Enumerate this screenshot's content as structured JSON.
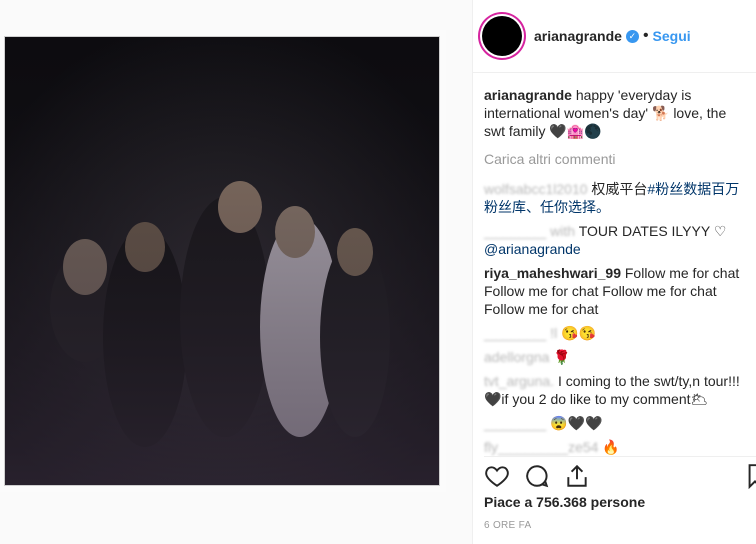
{
  "post": {
    "username": "arianagrande",
    "follow_label": "Segui",
    "separator": "•",
    "caption_user": "arianagrande",
    "caption_text": " happy 'everyday is international women's day' 🐕 love, the swt family 🖤🏩🌑",
    "load_more": "Carica altri commenti",
    "likes": "Piace a 756.368 persone",
    "time": "6 ORE FA"
  },
  "comments": [
    {
      "user": "",
      "prefix": "wolfsabcc1l2010 ",
      "text": "权威平台",
      "tag": "#粉丝数据百万粉丝库、任你选择。"
    },
    {
      "user": "",
      "prefix": "________ with ",
      "text": "TOUR DATES ILYYY ♡",
      "tag": "@arianagrande"
    },
    {
      "user": "riya_maheshwari_99",
      "prefix": "",
      "text": "Follow me for chat Follow me for chat Follow me for chat Follow me for chat",
      "tag": ""
    },
    {
      "user": "",
      "prefix": "________ !l ",
      "text": "😘😘",
      "tag": ""
    },
    {
      "user": "",
      "prefix": "adellorgna ",
      "text": "🌹",
      "tag": ""
    },
    {
      "user": "",
      "prefix": "tvt_arguna. ",
      "text": "I coming to the swt/ty,n tour!!!🖤if you 2 do like to my comment🌥",
      "tag": ""
    },
    {
      "user": "",
      "prefix": "________ ",
      "text": "😨🖤🖤",
      "tag": ""
    },
    {
      "user": "",
      "prefix": "fly_________ze54 ",
      "text": "🔥",
      "tag": ""
    }
  ],
  "icons": {
    "like": "heart-icon",
    "comment": "comment-icon",
    "share": "share-icon",
    "save": "bookmark-icon"
  },
  "colors": {
    "accent": "#3897f0",
    "muted": "#999999",
    "ring": "#d6249f"
  }
}
